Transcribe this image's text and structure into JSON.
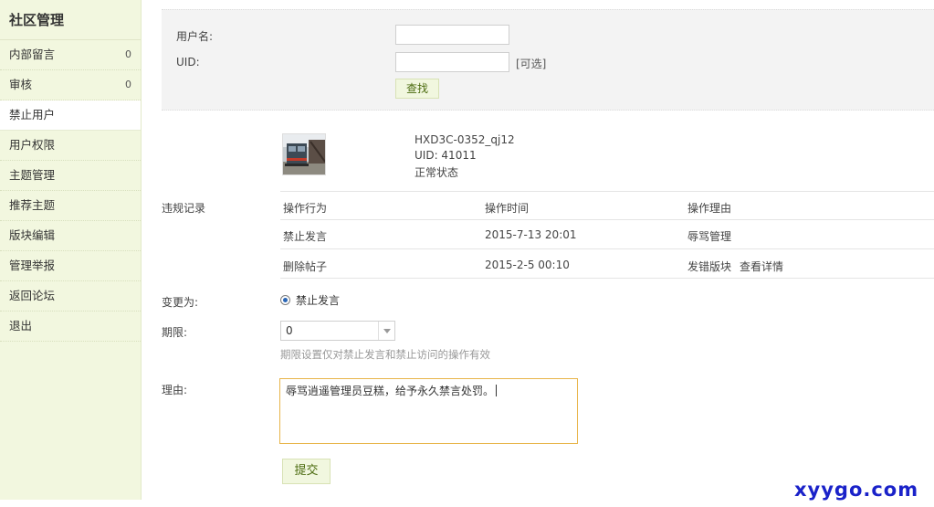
{
  "sidebar": {
    "title": "社区管理",
    "items": [
      {
        "label": "内部留言",
        "count": "0"
      },
      {
        "label": "审核",
        "count": "0"
      },
      {
        "label": "禁止用户",
        "count": ""
      },
      {
        "label": "用户权限",
        "count": ""
      },
      {
        "label": "主题管理",
        "count": ""
      },
      {
        "label": "推荐主题",
        "count": ""
      },
      {
        "label": "版块编辑",
        "count": ""
      },
      {
        "label": "管理举报",
        "count": ""
      },
      {
        "label": "返回论坛",
        "count": ""
      },
      {
        "label": "退出",
        "count": ""
      }
    ],
    "active_index": 2
  },
  "search": {
    "username_label": "用户名:",
    "username_value": "",
    "uid_label": "UID:",
    "uid_value": "",
    "optional_hint": "[可选]",
    "find_button": "查找"
  },
  "user": {
    "name": "HXD3C-0352_qj12",
    "uid": "UID: 41011",
    "status": "正常状态"
  },
  "records": {
    "label": "违规记录",
    "headers": [
      "操作行为",
      "操作时间",
      "操作理由"
    ],
    "rows": [
      {
        "action": "禁止发言",
        "time": "2015-7-13 20:01",
        "reason": "辱骂管理",
        "link": ""
      },
      {
        "action": "删除帖子",
        "time": "2015-2-5 00:10",
        "reason": "发错版块",
        "link": "查看详情"
      }
    ]
  },
  "form": {
    "change_label": "变更为:",
    "change_option": "禁止发言",
    "period_label": "期限:",
    "period_value": "0",
    "period_hint": "期限设置仅对禁止发言和禁止访问的操作有效",
    "reason_label": "理由:",
    "reason_value": "辱骂逍遥管理员豆糕，给予永久禁言处罚。",
    "submit_button": "提交"
  },
  "watermark": "xyygo.com",
  "colors": {
    "sidebar_bg": "#f2f7df",
    "button_bg": "#f1f7df",
    "button_text": "#4b6b0f",
    "textarea_focus": "#e8b54a",
    "watermark": "#1a22c9"
  }
}
